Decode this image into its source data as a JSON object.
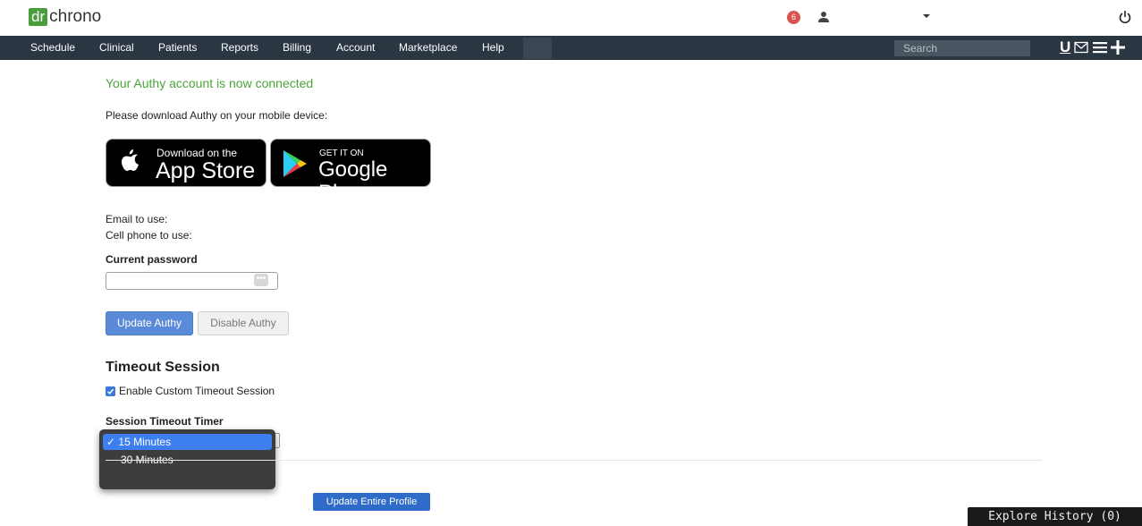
{
  "app": {
    "logo_dr": "dr",
    "logo_chrono": "chrono",
    "notification_count": "6"
  },
  "nav": {
    "items": [
      {
        "label": "Schedule"
      },
      {
        "label": "Clinical"
      },
      {
        "label": "Patients"
      },
      {
        "label": "Reports"
      },
      {
        "label": "Billing"
      },
      {
        "label": "Account"
      },
      {
        "label": "Marketplace"
      },
      {
        "label": "Help"
      }
    ],
    "search_placeholder": "Search",
    "u_label": "U"
  },
  "authy": {
    "connected_message": "Your Authy account is now connected",
    "download_prompt": "Please download Authy on your mobile device:",
    "app_store_small": "Download on the",
    "app_store_big": "App Store",
    "google_play_small": "GET IT ON",
    "google_play_big": "Google Play",
    "email_label": "Email to use:",
    "phone_label": "Cell phone to use:",
    "password_label": "Current password",
    "password_key_icon": "•••",
    "update_button": "Update Authy",
    "disable_button": "Disable Authy"
  },
  "timeout": {
    "heading": "Timeout Session",
    "checkbox_label": "Enable Custom Timeout Session",
    "checkbox_checked": true,
    "timer_label": "Session Timeout Timer",
    "options": [
      {
        "label": "✓ 15 Minutes",
        "selected": true
      },
      {
        "label": "30 Minutes",
        "selected": false
      }
    ]
  },
  "footer": {
    "update_profile_button": "Update Entire Profile",
    "explore_history": "Explore History (0)"
  },
  "colors": {
    "nav_bg": "#2b3643",
    "success_green": "#4aa538",
    "primary_blue": "#5b8ad8",
    "brand_green": "#4a9d3a"
  }
}
